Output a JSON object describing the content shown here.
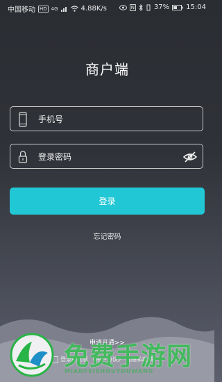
{
  "status_bar": {
    "carrier": "中国移动",
    "hd": "HD",
    "network": "4G",
    "speed": "4.88K/s",
    "nfc": "N",
    "battery": "37%",
    "time": "15:04"
  },
  "title": "商户端",
  "phone_field": {
    "placeholder": "手机号",
    "icon": "phone-icon"
  },
  "password_field": {
    "placeholder": "登录密码",
    "icon": "lock-icon",
    "toggle_icon": "eye-off-icon"
  },
  "login_button": "登录",
  "forgot_password": "忘记密码",
  "apply_link": "申请开通>>",
  "agreement": {
    "prefix": "登录即同意",
    "user_agreement": "《用户协议》",
    "privacy": "《隐私政策》"
  },
  "watermark": {
    "text": "免费手游网",
    "sub": "MIANFEISHOUYOUWANG"
  },
  "colors": {
    "accent": "#21c7d4",
    "watermark": "#28b446"
  }
}
